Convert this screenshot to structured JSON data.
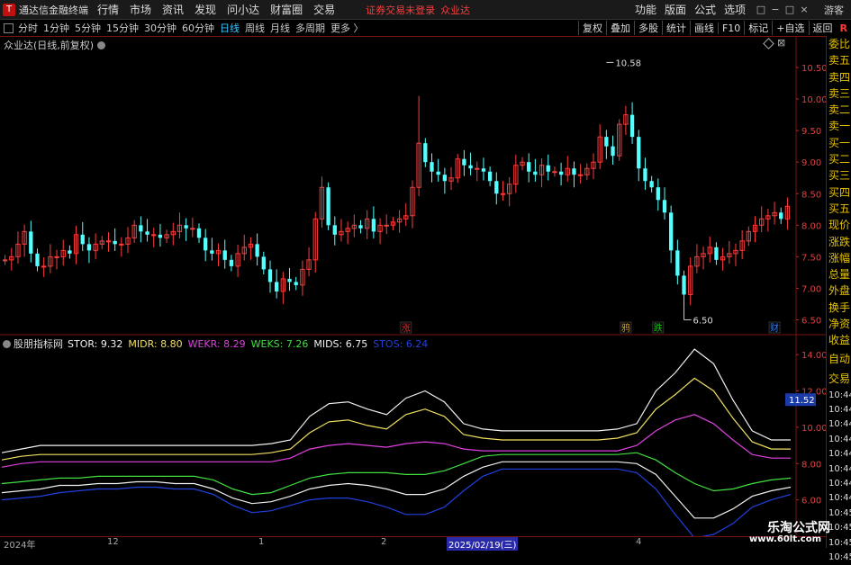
{
  "app_title": "通达信金融终端",
  "menu": [
    "行情",
    "市场",
    "资讯",
    "发现",
    "问小达",
    "财富圈",
    "交易"
  ],
  "notice": "证券交易未登录",
  "notice_stock": "众业达",
  "menu_right": [
    "功能",
    "版面",
    "公式",
    "选项"
  ],
  "guest": "游客",
  "window_controls": [
    "□",
    "−",
    "□",
    "×"
  ],
  "periods": [
    {
      "label": "分时",
      "active": false
    },
    {
      "label": "1分钟",
      "active": false
    },
    {
      "label": "5分钟",
      "active": false
    },
    {
      "label": "15分钟",
      "active": false
    },
    {
      "label": "30分钟",
      "active": false
    },
    {
      "label": "60分钟",
      "active": false
    },
    {
      "label": "日线",
      "active": true
    },
    {
      "label": "周线",
      "active": false
    },
    {
      "label": "月线",
      "active": false
    },
    {
      "label": "多周期",
      "active": false
    },
    {
      "label": "更多 〉",
      "active": false
    }
  ],
  "toolbar_right": [
    "复权",
    "叠加",
    "多股",
    "统计",
    "画线",
    "F10",
    "标记",
    "+自选",
    "返回"
  ],
  "corner_badge": "R",
  "chart_title": "众业达(日线,前复权)",
  "price_axis": [
    "10.50",
    "10.00",
    "9.50",
    "9.00",
    "8.50",
    "8.00",
    "7.50",
    "7.00",
    "6.50"
  ],
  "high_label": "10.58",
  "low_label": "6.50",
  "markers": [
    {
      "text": "涨",
      "color": "#e03030"
    },
    {
      "text": "鸦",
      "color": "#d4a020"
    },
    {
      "text": "跌",
      "color": "#20c020"
    },
    {
      "text": "财",
      "color": "#3080ff"
    }
  ],
  "side_quotes": [
    "委比",
    "卖五",
    "卖四",
    "卖三",
    "卖二",
    "卖一",
    "买一",
    "买二",
    "买三",
    "买四",
    "买五",
    "现价",
    "涨跌",
    "涨幅",
    "总量",
    "外盘",
    "换手",
    "净资",
    "收益"
  ],
  "side_auto": "自动",
  "side_trade": "交易",
  "side_times": [
    "10:44",
    "10:44",
    "10:44",
    "10:44",
    "10:44",
    "10:44",
    "10:44",
    "10:44",
    "10:45",
    "10:45",
    "10:45",
    "10:45"
  ],
  "indicator": {
    "name": "股朋指标网",
    "values": [
      {
        "label": "STOR: 9.32",
        "color": "#f0f0f0"
      },
      {
        "label": "MIDR: 8.80",
        "color": "#f0e060"
      },
      {
        "label": "WEKR: 8.29",
        "color": "#e040e0"
      },
      {
        "label": "WEKS: 7.26",
        "color": "#40e040"
      },
      {
        "label": "MIDS: 6.75",
        "color": "#f0f0f0"
      },
      {
        "label": "STOS: 6.24",
        "color": "#2040e0"
      }
    ],
    "axis": [
      "14.00",
      "12.00",
      "10.00",
      "8.00",
      "6.00"
    ],
    "current_value": "11.52"
  },
  "date_axis": [
    "2024年",
    "12",
    "1",
    "2",
    "4"
  ],
  "date_selected": "2025/02/19(三)",
  "watermark": "乐淘公式网",
  "watermark_url": "www.60lt.com",
  "colors": {
    "up": "#ff3c3c",
    "down": "#54ffff",
    "frame": "#7a1010"
  },
  "chart_data": [
    {
      "type": "candlestick",
      "title": "众业达(日线,前复权)",
      "y_axis_ticks": [
        10.5,
        10.0,
        9.5,
        9.0,
        8.5,
        8.0,
        7.5,
        7.0,
        6.5
      ],
      "ylim": [
        6.35,
        10.8
      ],
      "annotations": [
        {
          "text": "10.58",
          "value": 10.58
        },
        {
          "text": "6.50",
          "value": 6.5
        }
      ],
      "close": [
        7.45,
        7.5,
        7.7,
        7.9,
        7.55,
        7.35,
        7.35,
        7.5,
        7.5,
        7.6,
        7.55,
        7.85,
        7.7,
        7.6,
        7.7,
        7.75,
        7.75,
        7.7,
        7.7,
        7.8,
        8.0,
        7.9,
        7.85,
        7.85,
        7.8,
        7.85,
        7.9,
        8.0,
        7.95,
        7.95,
        7.8,
        7.6,
        7.55,
        7.6,
        7.45,
        7.35,
        7.55,
        7.65,
        7.7,
        7.5,
        7.3,
        7.1,
        6.95,
        7.15,
        7.1,
        7.05,
        7.3,
        7.45,
        8.1,
        8.6,
        8.0,
        7.85,
        7.9,
        7.95,
        8.0,
        7.95,
        8.1,
        7.9,
        8.0,
        8.0,
        8.05,
        8.1,
        8.15,
        8.6,
        9.3,
        9.0,
        8.85,
        8.8,
        8.7,
        8.75,
        9.05,
        8.95,
        8.9,
        8.9,
        8.85,
        8.7,
        8.5,
        8.5,
        8.65,
        8.95,
        9.0,
        8.85,
        8.8,
        8.95,
        8.85,
        8.85,
        8.8,
        8.9,
        8.8,
        8.8,
        8.9,
        9.0,
        9.4,
        9.25,
        9.1,
        9.6,
        9.75,
        9.4,
        8.9,
        8.7,
        8.6,
        8.4,
        8.2,
        7.6,
        7.2,
        6.9,
        7.35,
        7.5,
        7.55,
        7.65,
        7.45,
        7.5,
        7.55,
        7.6,
        7.75,
        7.9,
        8.0,
        8.1,
        8.15,
        8.2,
        8.1,
        8.3
      ],
      "open": [
        7.45,
        7.45,
        7.5,
        7.7,
        7.9,
        7.55,
        7.35,
        7.35,
        7.5,
        7.5,
        7.6,
        7.55,
        7.85,
        7.7,
        7.6,
        7.7,
        7.75,
        7.75,
        7.7,
        7.7,
        7.8,
        8.0,
        7.9,
        7.85,
        7.85,
        7.8,
        7.85,
        7.9,
        8.0,
        7.95,
        7.95,
        7.8,
        7.6,
        7.55,
        7.6,
        7.45,
        7.35,
        7.55,
        7.65,
        7.7,
        7.5,
        7.3,
        7.1,
        6.95,
        7.15,
        7.1,
        7.05,
        7.3,
        7.45,
        8.1,
        8.6,
        8.0,
        7.85,
        7.9,
        7.95,
        8.0,
        7.95,
        8.1,
        7.9,
        8.0,
        8.0,
        8.05,
        8.1,
        8.15,
        8.6,
        9.3,
        9.0,
        8.85,
        8.8,
        8.7,
        8.75,
        9.05,
        8.95,
        8.9,
        8.9,
        8.85,
        8.7,
        8.5,
        8.5,
        8.65,
        8.95,
        9.0,
        8.85,
        8.8,
        8.95,
        8.85,
        8.85,
        8.8,
        8.9,
        8.8,
        8.8,
        8.9,
        9.0,
        9.4,
        9.25,
        9.1,
        9.6,
        9.75,
        9.4,
        8.9,
        8.7,
        8.6,
        8.4,
        8.2,
        7.6,
        7.2,
        6.9,
        7.35,
        7.5,
        7.55,
        7.65,
        7.45,
        7.5,
        7.55,
        7.6,
        7.75,
        7.9,
        8.0,
        8.1,
        8.15,
        8.2,
        8.1
      ]
    },
    {
      "type": "line",
      "ylim": [
        4.0,
        15.0
      ],
      "y_axis_ticks": [
        14.0,
        12.0,
        10.0,
        8.0,
        6.0
      ],
      "series": [
        {
          "name": "STOR",
          "color": "#f0f0f0",
          "values": [
            8.6,
            8.8,
            9.0,
            9.0,
            9.0,
            9.0,
            9.0,
            9.0,
            9.0,
            9.0,
            9.0,
            9.0,
            9.0,
            9.0,
            9.1,
            9.3,
            10.6,
            11.3,
            11.4,
            11.0,
            10.7,
            11.6,
            12.0,
            11.4,
            10.2,
            9.9,
            9.8,
            9.8,
            9.8,
            9.8,
            9.8,
            9.8,
            9.9,
            10.2,
            12.0,
            13.0,
            14.3,
            13.5,
            11.5,
            9.8,
            9.3,
            9.3
          ]
        },
        {
          "name": "MIDR",
          "color": "#f0e060",
          "values": [
            8.2,
            8.4,
            8.5,
            8.5,
            8.5,
            8.5,
            8.5,
            8.5,
            8.5,
            8.5,
            8.5,
            8.5,
            8.5,
            8.5,
            8.6,
            8.8,
            9.7,
            10.3,
            10.4,
            10.1,
            9.9,
            10.7,
            11.0,
            10.6,
            9.6,
            9.4,
            9.3,
            9.3,
            9.3,
            9.3,
            9.3,
            9.3,
            9.4,
            9.7,
            11.0,
            11.8,
            12.7,
            12.0,
            10.5,
            9.2,
            8.8,
            8.8
          ]
        },
        {
          "name": "WEKR",
          "color": "#e040e0",
          "values": [
            7.8,
            8.0,
            8.1,
            8.1,
            8.1,
            8.1,
            8.1,
            8.1,
            8.1,
            8.1,
            8.1,
            8.1,
            8.1,
            8.1,
            8.1,
            8.3,
            8.8,
            9.0,
            9.1,
            9.0,
            8.9,
            9.1,
            9.2,
            9.1,
            8.8,
            8.7,
            8.7,
            8.7,
            8.7,
            8.7,
            8.7,
            8.7,
            8.7,
            9.0,
            9.8,
            10.4,
            10.7,
            10.2,
            9.3,
            8.5,
            8.3,
            8.3
          ]
        },
        {
          "name": "WEKS",
          "color": "#40e040",
          "values": [
            6.9,
            7.0,
            7.1,
            7.2,
            7.2,
            7.3,
            7.3,
            7.3,
            7.3,
            7.3,
            7.3,
            7.1,
            6.6,
            6.3,
            6.4,
            6.8,
            7.2,
            7.4,
            7.5,
            7.5,
            7.5,
            7.4,
            7.4,
            7.6,
            8.0,
            8.4,
            8.5,
            8.5,
            8.5,
            8.5,
            8.5,
            8.5,
            8.5,
            8.6,
            8.2,
            7.5,
            6.9,
            6.5,
            6.6,
            6.9,
            7.1,
            7.2
          ]
        },
        {
          "name": "MIDS",
          "color": "#f0f0f0",
          "values": [
            6.4,
            6.5,
            6.6,
            6.8,
            6.8,
            6.9,
            6.9,
            7.0,
            7.0,
            6.9,
            6.9,
            6.6,
            6.1,
            5.8,
            5.9,
            6.2,
            6.6,
            6.8,
            6.9,
            6.8,
            6.6,
            6.3,
            6.3,
            6.6,
            7.3,
            7.8,
            8.1,
            8.1,
            8.1,
            8.1,
            8.1,
            8.1,
            8.1,
            8.0,
            7.4,
            6.2,
            5.0,
            5.0,
            5.5,
            6.2,
            6.5,
            6.7
          ]
        },
        {
          "name": "STOS",
          "color": "#2040e0",
          "values": [
            6.0,
            6.1,
            6.2,
            6.4,
            6.5,
            6.6,
            6.6,
            6.7,
            6.7,
            6.6,
            6.6,
            6.3,
            5.7,
            5.3,
            5.4,
            5.7,
            6.0,
            6.1,
            6.1,
            5.9,
            5.6,
            5.2,
            5.2,
            5.6,
            6.5,
            7.3,
            7.7,
            7.7,
            7.7,
            7.7,
            7.7,
            7.7,
            7.7,
            7.5,
            6.6,
            5.2,
            3.9,
            4.1,
            4.7,
            5.6,
            6.0,
            6.3
          ]
        }
      ]
    }
  ]
}
